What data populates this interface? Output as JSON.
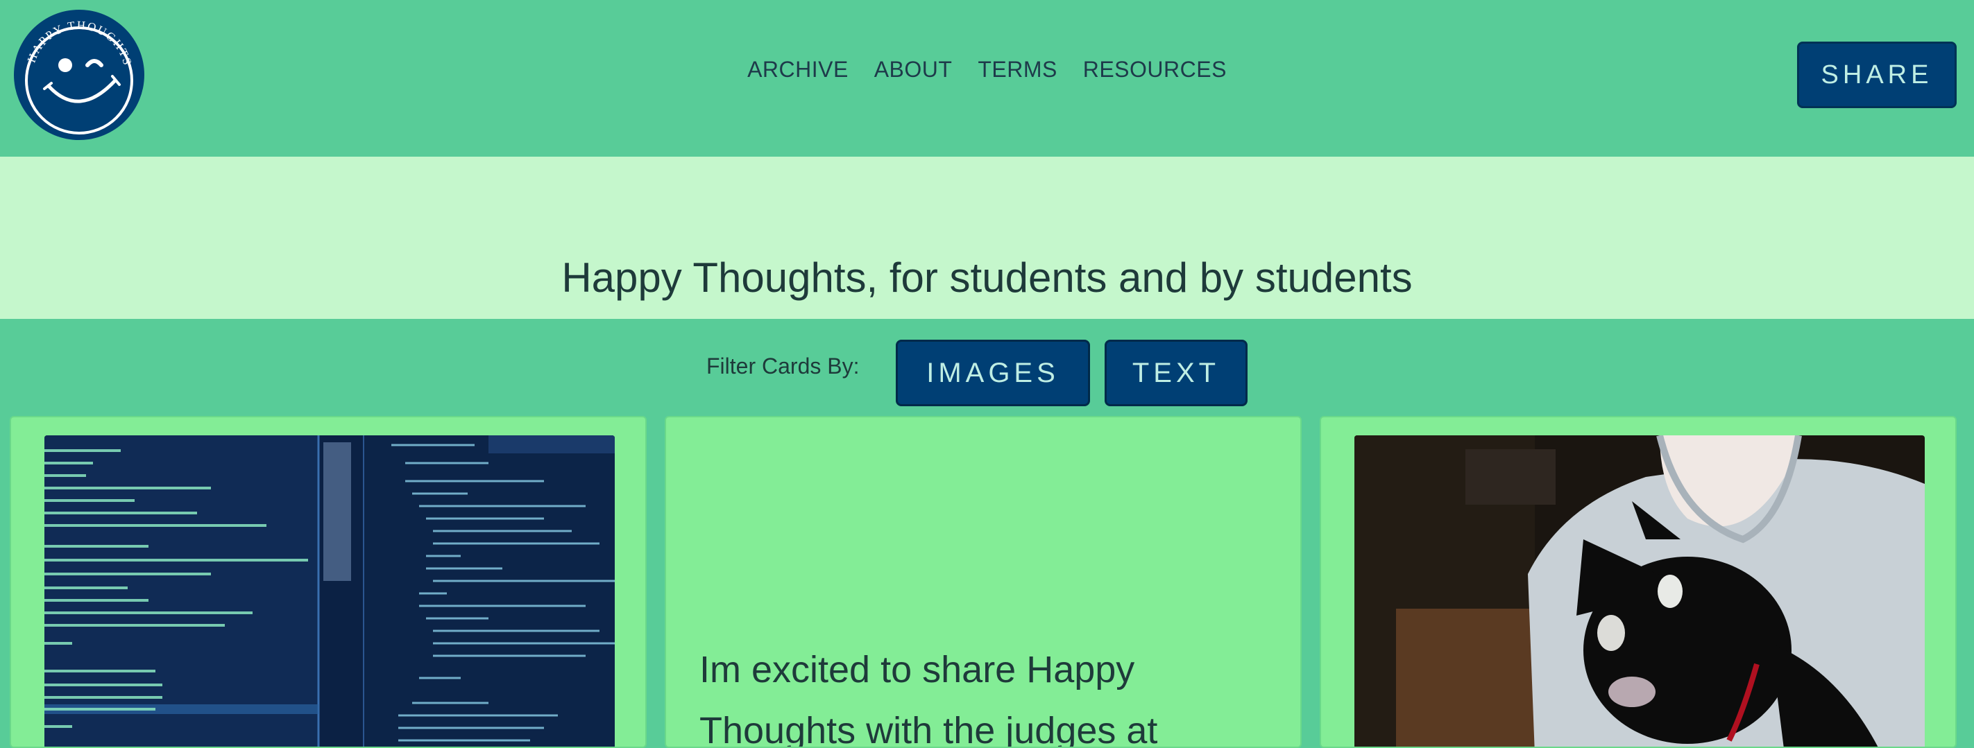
{
  "logo": {
    "text": "HAPPY THOUGHTS",
    "icon": "winking-smiley-logo"
  },
  "nav": {
    "links": [
      "ARCHIVE",
      "ABOUT",
      "TERMS",
      "RESOURCES"
    ],
    "share_label": "SHARE"
  },
  "hero": {
    "title": "Happy Thoughts, for students and by students"
  },
  "filter": {
    "label": "Filter Cards By:",
    "images_label": "IMAGES",
    "text_label": "TEXT"
  },
  "cards": [
    {
      "type": "image",
      "image": "code-editor-screenshot"
    },
    {
      "type": "text",
      "text": "Im excited to share Happy Thoughts with the judges at"
    },
    {
      "type": "image",
      "image": "person-holding-black-cat"
    }
  ],
  "colors": {
    "nav_bg": "#58cc98",
    "hero_bg": "#c5f7cc",
    "card_bg": "#83ed96",
    "button_bg": "#003f74"
  }
}
